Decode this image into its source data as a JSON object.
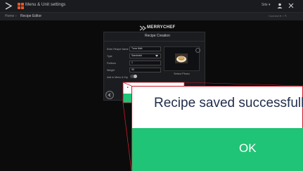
{
  "topbar": {
    "title": "Menu & Unit settings",
    "user": "Site ▾"
  },
  "breadcrumb": {
    "home": "Home",
    "separator": "›",
    "current": "Recipe Editor",
    "right_info": "Connect ▾  ⌂  ✎"
  },
  "brand": {
    "name": "MERRYCHEF"
  },
  "panel": {
    "title": "Recipe Creation",
    "fields": {
      "name_label": "Enter Recipe Name",
      "name_value": "Tuna Melt",
      "type_label": "Type",
      "type_value": "Sandwich",
      "portions_label": "Portions",
      "portions_value": "1",
      "weight_label": "Weight",
      "weight_value": "90",
      "add_to_menu_label": "Add to Menu & Grp"
    },
    "select_photo": "Select Photo"
  },
  "dialog": {
    "message": "Recipe saved successfull",
    "ok_label": "OK"
  },
  "colors": {
    "ok_green": "#1fc476",
    "zoom_border": "#cc1b2b",
    "dialog_text": "#1f2d4b",
    "logo_orange": "#e8562a"
  }
}
